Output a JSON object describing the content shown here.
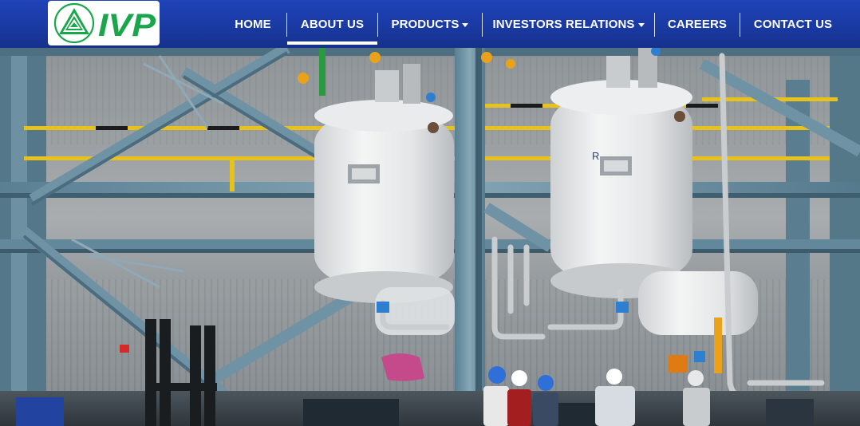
{
  "brand": {
    "name": "IVP",
    "logo_icon": "ivp-triangle-logo",
    "colors": {
      "green": "#1aa64a",
      "nav_blue": "#1c3ea8",
      "white": "#ffffff"
    }
  },
  "nav": {
    "items": [
      {
        "label": "HOME",
        "dropdown": false,
        "active": false
      },
      {
        "label": "ABOUT US",
        "dropdown": false,
        "active": true
      },
      {
        "label": "PRODUCTS",
        "dropdown": true,
        "active": false
      },
      {
        "label": "INVESTORS RELATIONS",
        "dropdown": true,
        "active": false
      },
      {
        "label": "CAREERS",
        "dropdown": false,
        "active": false
      },
      {
        "label": "CONTACT US",
        "dropdown": false,
        "active": false
      }
    ]
  },
  "hero": {
    "image": "industrial-reactor-plant-photo",
    "vessel_tag": "R"
  }
}
